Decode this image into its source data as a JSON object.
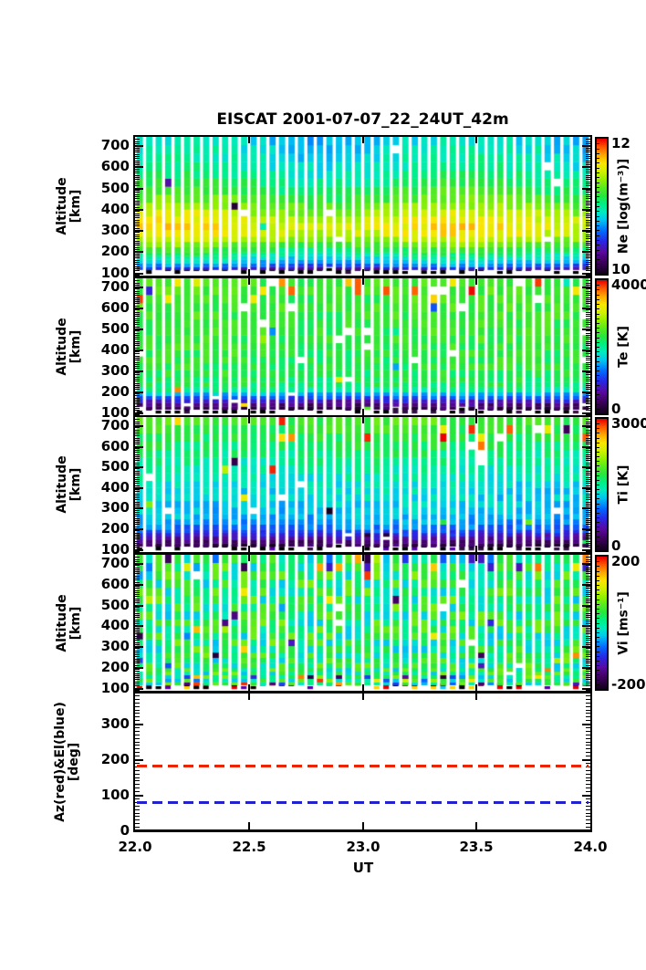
{
  "title": "EISCAT 2001-07-07_22_24UT_42m",
  "x_axis": {
    "label": "UT",
    "tick_labels": [
      "22.0",
      "22.5",
      "23.0",
      "23.5",
      "24.0"
    ],
    "tick_values": [
      22.0,
      22.5,
      23.0,
      23.5,
      24.0
    ],
    "range": [
      22.0,
      24.0
    ]
  },
  "alt_axis": {
    "label_line1": "Altitude",
    "label_line2": "[km]",
    "tick_labels": [
      "700",
      "600",
      "500",
      "400",
      "300",
      "200",
      "100"
    ],
    "tick_values": [
      700,
      600,
      500,
      400,
      300,
      200,
      100
    ],
    "range_km": [
      85,
      740
    ]
  },
  "chart_data": [
    {
      "type": "heatmap",
      "name": "Ne",
      "colorbar": {
        "label": "Ne [log(m⁻³)]",
        "top_tick": "12",
        "bottom_tick": "10"
      },
      "clim": [
        10,
        12
      ],
      "time_range_ut": [
        22.0,
        24.0
      ],
      "n_time_steps": 48,
      "altitude_profile": [
        [
          740,
          10.82
        ],
        [
          650,
          10.9
        ],
        [
          560,
          11.0
        ],
        [
          470,
          11.18
        ],
        [
          410,
          11.35
        ],
        [
          350,
          11.55
        ],
        [
          300,
          11.6
        ],
        [
          260,
          11.45
        ],
        [
          220,
          11.2
        ],
        [
          185,
          11.0
        ],
        [
          160,
          10.85
        ],
        [
          140,
          10.7
        ],
        [
          125,
          10.5
        ],
        [
          110,
          10.25
        ],
        [
          85,
          10.05
        ]
      ],
      "noise_sigma": 0.055,
      "column_modulation": 0.045,
      "missing_prob": 0.004,
      "top_outliers": {
        "min_alt_km": 9999,
        "prob": 0,
        "add_range": [
          0,
          0
        ]
      },
      "rand_outliers": {
        "prob": 0.006
      },
      "bottom_row_palette": [
        "#000000",
        "#000000",
        "#000000",
        "#000000",
        "#ffffff",
        "#301040"
      ],
      "seed": 7
    },
    {
      "type": "heatmap",
      "name": "Te",
      "colorbar": {
        "label": "Te [K]",
        "top_tick": "4000",
        "bottom_tick": "0"
      },
      "clim": [
        0,
        4000
      ],
      "time_range_ut": [
        22.0,
        24.0
      ],
      "n_time_steps": 48,
      "altitude_profile": [
        [
          740,
          2450
        ],
        [
          600,
          2400
        ],
        [
          450,
          2350
        ],
        [
          350,
          2300
        ],
        [
          280,
          2250
        ],
        [
          230,
          2150
        ],
        [
          205,
          1950
        ],
        [
          190,
          1600
        ],
        [
          175,
          1250
        ],
        [
          160,
          950
        ],
        [
          145,
          650
        ],
        [
          130,
          380
        ],
        [
          115,
          230
        ],
        [
          85,
          130
        ]
      ],
      "noise_sigma": 130,
      "column_modulation": 0.012,
      "missing_prob": 0.022,
      "top_outliers": {
        "min_alt_km": 620,
        "prob": 0.1,
        "add_range": [
          600,
          1700
        ]
      },
      "rand_outliers": {
        "prob": 0.012
      },
      "bottom_row_palette": [
        "#000000",
        "#000000",
        "#000000",
        "#000000",
        "#ffffff",
        "#301040"
      ],
      "seed": 13
    },
    {
      "type": "heatmap",
      "name": "Ti",
      "colorbar": {
        "label": "Ti [K]",
        "top_tick": "3000",
        "bottom_tick": "0"
      },
      "clim": [
        0,
        3000
      ],
      "time_range_ut": [
        22.0,
        24.0
      ],
      "n_time_steps": 48,
      "altitude_profile": [
        [
          740,
          1850
        ],
        [
          680,
          1760
        ],
        [
          620,
          1680
        ],
        [
          560,
          1570
        ],
        [
          500,
          1460
        ],
        [
          440,
          1360
        ],
        [
          380,
          1290
        ],
        [
          320,
          1240
        ],
        [
          270,
          1190
        ],
        [
          230,
          1090
        ],
        [
          200,
          930
        ],
        [
          180,
          770
        ],
        [
          160,
          570
        ],
        [
          140,
          370
        ],
        [
          120,
          210
        ],
        [
          85,
          120
        ]
      ],
      "noise_sigma": 95,
      "column_modulation": 0.015,
      "missing_prob": 0.02,
      "top_outliers": {
        "min_alt_km": 640,
        "prob": 0.12,
        "add_range": [
          500,
          1400
        ]
      },
      "rand_outliers": {
        "prob": 0.012
      },
      "bottom_row_palette": [
        "#000000",
        "#000000",
        "#000000",
        "#301040",
        "#ffffff",
        "#5500aa"
      ],
      "seed": 21
    },
    {
      "type": "heatmap",
      "name": "Vi",
      "colorbar": {
        "label": "Vi [ms⁻¹]",
        "top_tick": "200",
        "bottom_tick": "-200"
      },
      "clim": [
        -200,
        200
      ],
      "time_range_ut": [
        22.0,
        24.0
      ],
      "n_time_steps": 48,
      "altitude_profile": [
        [
          740,
          15
        ],
        [
          85,
          15
        ]
      ],
      "noise_sigma": 38,
      "column_modulation": 0,
      "missing_prob": 0.012,
      "top_outliers": {
        "min_alt_km": 9999,
        "prob": 0,
        "add_range": [
          0,
          0
        ]
      },
      "rand_outliers": {
        "prob": 0.05,
        "edge_prob": 0.3,
        "top_alt_km": 650,
        "bottom_alt_km": 155
      },
      "bottom_row_palette": [
        "#000000",
        "#000000",
        "#000000",
        "#dd0000",
        "#dd0000",
        "#00ccff",
        "#ffd000",
        "#5500aa",
        "#ffffff"
      ],
      "seed": 42
    },
    {
      "type": "line",
      "name": "pointing",
      "ylabel_line1": "Az(red)&El(blue)",
      "ylabel_line2": "[deg]",
      "ylim": [
        0,
        385
      ],
      "ytick_values": [
        0,
        100,
        200,
        300
      ],
      "ytick_labels": [
        "0",
        "100",
        "200",
        "300"
      ],
      "series": [
        {
          "name": "azimuth",
          "color": "#ee2200",
          "style": "dashed",
          "value_deg": 183
        },
        {
          "name": "elevation",
          "color": "#2222cc",
          "style": "dashed",
          "value_deg": 79
        }
      ]
    }
  ]
}
